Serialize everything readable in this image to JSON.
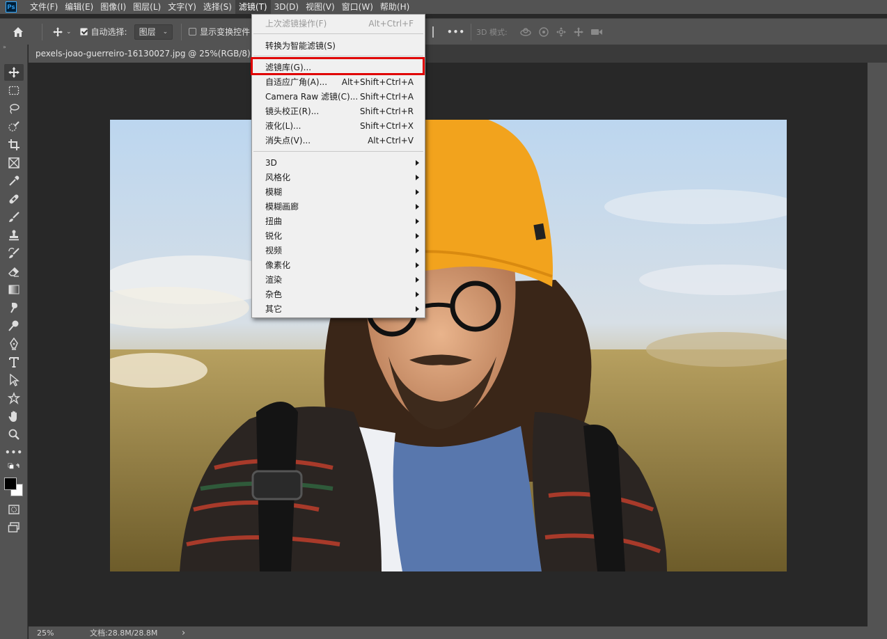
{
  "menubar": {
    "logo": "Ps",
    "items": [
      "文件(F)",
      "编辑(E)",
      "图像(I)",
      "图层(L)",
      "文字(Y)",
      "选择(S)",
      "滤镜(T)",
      "3D(D)",
      "视图(V)",
      "窗口(W)",
      "帮助(H)"
    ],
    "active": "滤镜(T)"
  },
  "options": {
    "auto_select_label": "自动选择:",
    "auto_select_checked": true,
    "auto_select_target": "图层",
    "show_transform_label": "显示变换控件",
    "show_transform_checked": false,
    "more": "•••",
    "mode_3d_label": "3D 模式:"
  },
  "document": {
    "tab_title": "pexels-joao-guerreiro-16130027.jpg @ 25%(RGB/8)",
    "close": "×"
  },
  "filter_menu": {
    "last_filter": {
      "label": "上次滤镜操作(F)",
      "shortcut": "Alt+Ctrl+F"
    },
    "smart_filter": {
      "label": "转换为智能滤镜(S)"
    },
    "group1": [
      {
        "label": "滤镜库(G)...",
        "shortcut": ""
      },
      {
        "label": "自适应广角(A)...",
        "shortcut": "Alt+Shift+Ctrl+A"
      },
      {
        "label": "Camera Raw 滤镜(C)...",
        "shortcut": "Shift+Ctrl+A"
      },
      {
        "label": "镜头校正(R)...",
        "shortcut": "Shift+Ctrl+R"
      },
      {
        "label": "液化(L)...",
        "shortcut": "Shift+Ctrl+X"
      },
      {
        "label": "消失点(V)...",
        "shortcut": "Alt+Ctrl+V"
      }
    ],
    "submenus": [
      "3D",
      "风格化",
      "模糊",
      "模糊画廊",
      "扭曲",
      "锐化",
      "视频",
      "像素化",
      "渲染",
      "杂色",
      "其它"
    ],
    "highlighted": "滤镜库(G)..."
  },
  "status": {
    "zoom": "25%",
    "doc_size": "文档:28.8M/28.8M",
    "arrow": "›"
  },
  "colors": {
    "highlight_border": "#e00000",
    "panel_bg": "#535353",
    "workspace_bg": "#282828",
    "menu_bg": "#f0f0f0"
  }
}
